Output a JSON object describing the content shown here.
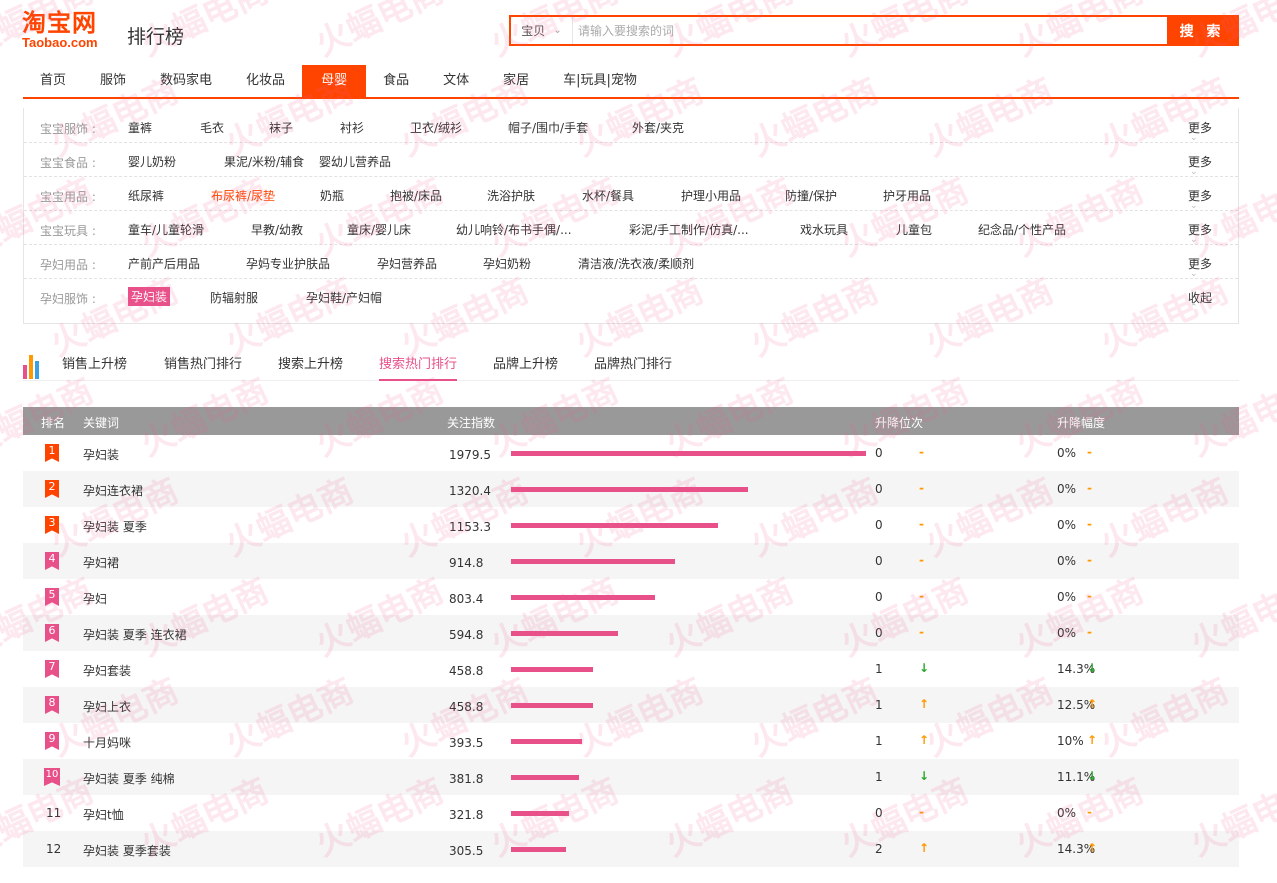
{
  "header": {
    "logo_cn": "淘宝网",
    "logo_en": "Taobao.com",
    "title": "排行榜",
    "search_scope": "宝贝",
    "search_placeholder": "请输入要搜索的词",
    "search_button": "搜 索"
  },
  "nav": [
    "首页",
    "服饰",
    "数码家电",
    "化妆品",
    "母婴",
    "食品",
    "文体",
    "家居",
    "车|玩具|宠物"
  ],
  "nav_active": "母婴",
  "categories": [
    {
      "label": "宝宝服饰 :",
      "items": [
        "童裤",
        "毛衣",
        "袜子",
        "衬衫",
        "卫衣/绒衫",
        "帽子/围巾/手套",
        "外套/夹克"
      ],
      "more": "更多"
    },
    {
      "label": "宝宝食品 :",
      "items": [
        "婴儿奶粉",
        "果泥/米粉/辅食",
        "婴幼儿营养品"
      ],
      "more": "更多"
    },
    {
      "label": "宝宝用品 :",
      "items": [
        "纸尿裤",
        "布尿裤/尿垫",
        "奶瓶",
        "抱被/床品",
        "洗浴护肤",
        "水杯/餐具",
        "护理小用品",
        "防撞/保护",
        "护牙用品"
      ],
      "more": "更多"
    },
    {
      "label": "宝宝玩具 :",
      "items": [
        "童车/儿童轮滑",
        "早教/幼教",
        "童床/婴儿床",
        "幼儿响铃/布书手偶/...",
        "彩泥/手工制作/仿真/...",
        "戏水玩具",
        "儿童包",
        "纪念品/个性产品"
      ],
      "more": "更多"
    },
    {
      "label": "孕妇用品 :",
      "items": [
        "产前产后用品",
        "孕妈专业护肤品",
        "孕妇营养品",
        "孕妇奶粉",
        "清洁液/洗衣液/柔顺剂"
      ],
      "more": "更多"
    },
    {
      "label": "孕妇服饰 :",
      "items": [
        "孕妇装",
        "防辐射服",
        "孕妇鞋/产妇帽"
      ],
      "more": "收起"
    }
  ],
  "tabs": [
    "销售上升榜",
    "销售热门排行",
    "搜索上升榜",
    "搜索热门排行",
    "品牌上升榜",
    "品牌热门排行"
  ],
  "tab_active": "搜索热门排行",
  "table": {
    "headers": [
      "排名",
      "关键词",
      "关注指数",
      "升降位次",
      "升降幅度"
    ],
    "rows": [
      {
        "rank": "1",
        "keyword": "孕妇装",
        "index": "1979.5",
        "change": "0",
        "trend": "flat",
        "pct": "0%"
      },
      {
        "rank": "2",
        "keyword": "孕妇连衣裙",
        "index": "1320.4",
        "change": "0",
        "trend": "flat",
        "pct": "0%"
      },
      {
        "rank": "3",
        "keyword": "孕妇装 夏季",
        "index": "1153.3",
        "change": "0",
        "trend": "flat",
        "pct": "0%"
      },
      {
        "rank": "4",
        "keyword": "孕妇裙",
        "index": "914.8",
        "change": "0",
        "trend": "flat",
        "pct": "0%"
      },
      {
        "rank": "5",
        "keyword": "孕妇",
        "index": "803.4",
        "change": "0",
        "trend": "flat",
        "pct": "0%"
      },
      {
        "rank": "6",
        "keyword": "孕妇装 夏季 连衣裙",
        "index": "594.8",
        "change": "0",
        "trend": "flat",
        "pct": "0%"
      },
      {
        "rank": "7",
        "keyword": "孕妇套装",
        "index": "458.8",
        "change": "1",
        "trend": "down",
        "pct": "14.3%"
      },
      {
        "rank": "8",
        "keyword": "孕妇上衣",
        "index": "458.8",
        "change": "1",
        "trend": "up",
        "pct": "12.5%"
      },
      {
        "rank": "9",
        "keyword": "十月妈咪",
        "index": "393.5",
        "change": "1",
        "trend": "up",
        "pct": "10%"
      },
      {
        "rank": "10",
        "keyword": "孕妇装 夏季 纯棉",
        "index": "381.8",
        "change": "1",
        "trend": "down",
        "pct": "11.1%"
      },
      {
        "rank": "11",
        "keyword": "孕妇t恤",
        "index": "321.8",
        "change": "0",
        "trend": "flat",
        "pct": "0%"
      },
      {
        "rank": "12",
        "keyword": "孕妇装 夏季套装",
        "index": "305.5",
        "change": "2",
        "trend": "up",
        "pct": "14.3%"
      }
    ]
  },
  "watermark": "火蝠电商",
  "colors": {
    "brand": "#ff4400",
    "pink": "#e8508a",
    "badge_top": "#ff4400",
    "badge_other": "#e8508a",
    "flat": "#ff9900",
    "up": "#ff9900",
    "down": "#2aa82a"
  },
  "icons": {
    "trend_flat": "dash-icon",
    "trend_up": "arrow-up-icon",
    "trend_down": "arrow-down-icon",
    "tabs": "bar-chart-icon"
  }
}
